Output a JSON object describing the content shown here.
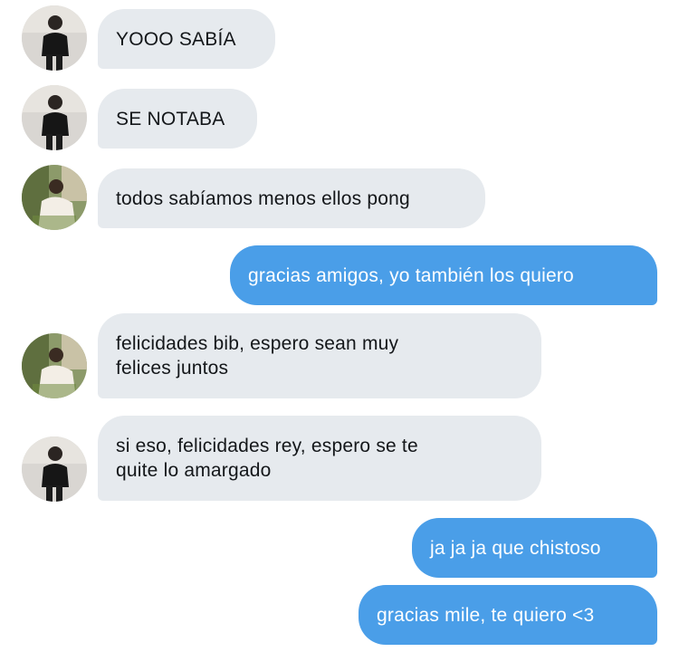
{
  "conversation": {
    "messages": [
      {
        "sender": "friend-1",
        "direction": "incoming",
        "text": "YOOO SABÍA"
      },
      {
        "sender": "friend-1",
        "direction": "incoming",
        "text": "SE NOTABA"
      },
      {
        "sender": "friend-2",
        "direction": "incoming",
        "text": "todos sabíamos menos ellos pong"
      },
      {
        "sender": "me",
        "direction": "outgoing",
        "text": "gracias amigos, yo también los quiero"
      },
      {
        "sender": "friend-2",
        "direction": "incoming",
        "text": "felicidades bib, espero sean muy\nfelices juntos"
      },
      {
        "sender": "friend-1",
        "direction": "incoming",
        "text": "si eso, felicidades rey, espero se te\nquite lo amargado"
      },
      {
        "sender": "me",
        "direction": "outgoing",
        "text": "ja ja ja que chistoso"
      },
      {
        "sender": "me",
        "direction": "outgoing",
        "text": "gracias mile, te quiero <3"
      }
    ]
  },
  "colors": {
    "incoming_bubble": "#e6eaee",
    "outgoing_bubble": "#4a9ee8",
    "incoming_text": "#14171a",
    "outgoing_text": "#ffffff"
  },
  "icons": {
    "avatar_friend_1": "person-in-black-avatar-icon",
    "avatar_friend_2": "person-in-white-shirt-avatar-icon"
  }
}
